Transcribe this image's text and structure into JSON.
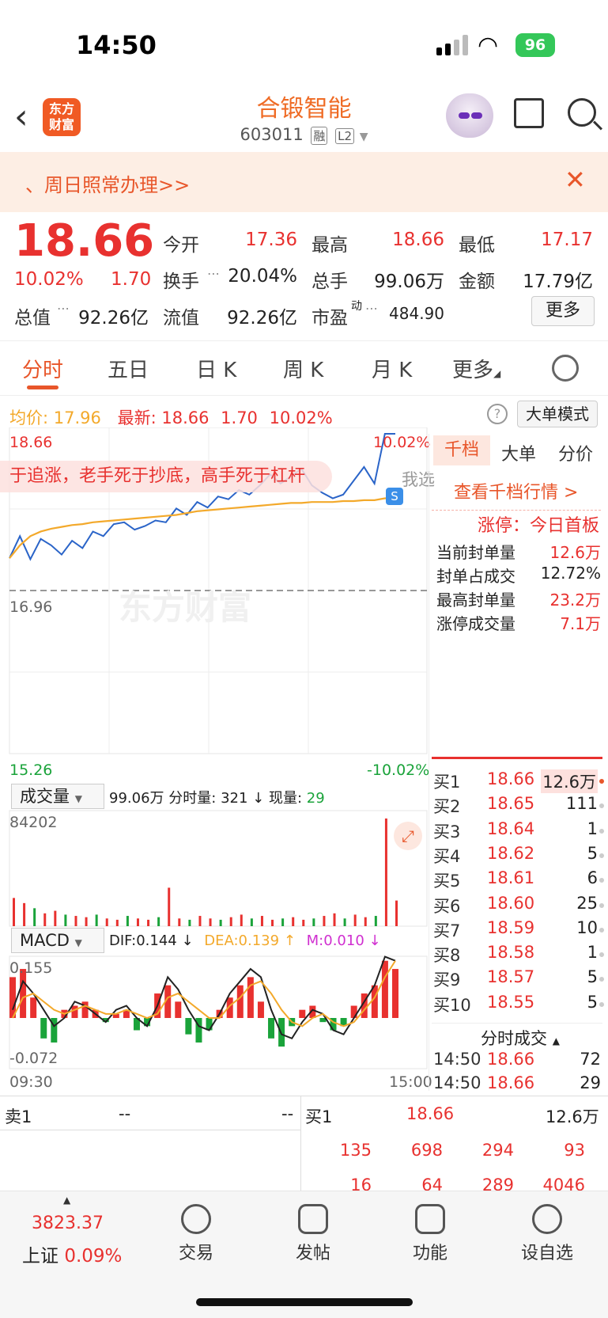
{
  "status": {
    "time": "14:50",
    "battery": "96"
  },
  "header": {
    "title": "合锻智能",
    "code": "603011",
    "tag_margin": "融",
    "tag_level": "L2",
    "logo_line1": "东方",
    "logo_line2": "财富"
  },
  "notice": {
    "text": "、周日照常办理>>",
    "close": "✕"
  },
  "quote": {
    "price": "18.66",
    "change_pct": "10.02%",
    "change": "1.70",
    "open_label": "今开",
    "open": "17.36",
    "high_label": "最高",
    "high": "18.66",
    "low_label": "最低",
    "low": "17.17",
    "turnover_label": "换手",
    "turnover": "20.04%",
    "volume_label": "总手",
    "volume": "99.06万",
    "amount_label": "金额",
    "amount": "17.79亿",
    "mktcap_label": "总值",
    "mktcap": "92.26亿",
    "float_label": "流值",
    "float": "92.26亿",
    "pe_label": "市盈",
    "pe_sup": "动",
    "pe": "484.90",
    "more": "更多"
  },
  "tabs": [
    "分时",
    "五日",
    "日 K",
    "周 K",
    "月 K",
    "更多"
  ],
  "chart_info": {
    "avg_label": "均价:",
    "avg": "17.96",
    "latest_label": "最新:",
    "latest": "18.66",
    "chg": "1.70",
    "pct": "10.02%",
    "big_mode": "大单模式",
    "help": "?"
  },
  "chart_data": {
    "type": "line",
    "y_top": "18.66",
    "y_mid": "16.96",
    "y_bottom": "15.26",
    "pct_top": "10.02%",
    "pct_bottom": "-10.02%",
    "x_start": "09:30",
    "x_end": "15:00",
    "ylim": [
      15.26,
      18.66
    ],
    "watermark": "东方财富",
    "ticker_text": "于追涨，老手死于抄底，高手死于杠杆",
    "ticker_side": "我选",
    "series": [
      {
        "name": "最新",
        "color": "#2a64c8",
        "values": [
          17.31,
          17.55,
          17.3,
          17.52,
          17.45,
          17.35,
          17.5,
          17.42,
          17.6,
          17.55,
          17.68,
          17.7,
          17.62,
          17.66,
          17.72,
          17.7,
          17.85,
          17.78,
          17.92,
          17.86,
          17.98,
          17.95,
          18.05,
          18.0,
          18.1,
          18.22,
          18.12,
          18.2,
          18.28,
          18.1,
          18.02,
          17.96,
          18.0,
          18.15,
          18.3,
          18.12,
          18.66,
          18.66
        ]
      },
      {
        "name": "均价",
        "color": "#f3a92b",
        "values": [
          17.31,
          17.45,
          17.55,
          17.6,
          17.63,
          17.65,
          17.67,
          17.68,
          17.7,
          17.71,
          17.72,
          17.73,
          17.74,
          17.75,
          17.76,
          17.77,
          17.78,
          17.8,
          17.82,
          17.83,
          17.84,
          17.85,
          17.86,
          17.87,
          17.88,
          17.89,
          17.9,
          17.91,
          17.91,
          17.92,
          17.92,
          17.92,
          17.93,
          17.93,
          17.94,
          17.94,
          17.96,
          17.96
        ]
      }
    ],
    "volume_label": "成交量",
    "volume_total": "99.06万",
    "tick_label": "分时量:",
    "tick_vol": "321",
    "now_label": "现量:",
    "now_vol": "29",
    "volume_max": "84202",
    "volume_values": [
      22,
      18,
      14,
      10,
      12,
      9,
      8,
      7,
      9,
      6,
      5,
      8,
      6,
      5,
      7,
      30,
      6,
      5,
      8,
      6,
      5,
      7,
      9,
      6,
      8,
      5,
      6,
      7,
      5,
      6,
      8,
      10,
      6,
      9,
      7,
      8,
      84,
      20
    ],
    "macd_label": "MACD",
    "dif_label": "DIF:0.144 ↓",
    "dea_label": "DEA:0.139 ↑",
    "m_label": "M:0.010 ↓",
    "macd_top": "0.155",
    "macd_bottom": "-0.072",
    "macd_hist": [
      0.1,
      0.12,
      0.05,
      -0.05,
      -0.06,
      0.02,
      0.03,
      0.04,
      0.02,
      -0.01,
      0.01,
      0.02,
      -0.03,
      -0.02,
      0.06,
      0.08,
      0.04,
      -0.04,
      -0.06,
      -0.03,
      0.02,
      0.05,
      0.08,
      0.1,
      0.04,
      -0.05,
      -0.07,
      -0.02,
      0.02,
      0.03,
      -0.01,
      -0.03,
      -0.02,
      0.03,
      0.06,
      0.08,
      0.14,
      0.12
    ],
    "macd_dif": [
      0.02,
      0.09,
      0.06,
      0.02,
      -0.02,
      0.0,
      0.04,
      0.03,
      0.01,
      -0.01,
      0.02,
      0.03,
      0.0,
      -0.02,
      0.03,
      0.1,
      0.07,
      0.02,
      -0.02,
      -0.03,
      0.01,
      0.06,
      0.09,
      0.12,
      0.1,
      0.02,
      -0.04,
      -0.05,
      -0.01,
      0.02,
      0.01,
      -0.03,
      -0.04,
      0.0,
      0.04,
      0.08,
      0.15,
      0.14
    ],
    "macd_dea": [
      0.0,
      0.05,
      0.06,
      0.04,
      0.02,
      0.01,
      0.02,
      0.03,
      0.02,
      0.01,
      0.01,
      0.02,
      0.01,
      0.0,
      0.01,
      0.05,
      0.06,
      0.04,
      0.02,
      0.0,
      0.0,
      0.03,
      0.05,
      0.08,
      0.09,
      0.06,
      0.02,
      -0.01,
      -0.02,
      0.0,
      0.01,
      -0.01,
      -0.02,
      -0.01,
      0.02,
      0.05,
      0.1,
      0.14
    ]
  },
  "right_panel": {
    "tabs": [
      "千档",
      "大单",
      "分价"
    ],
    "link": "查看千档行情 >",
    "limit_label": "涨停：今日首板",
    "stats": [
      {
        "label": "当前封单量",
        "value": "12.6万"
      },
      {
        "label": "封单占成交",
        "value": "12.72%"
      },
      {
        "label": "最高封单量",
        "value": "23.2万"
      },
      {
        "label": "涨停成交量",
        "value": "7.1万"
      }
    ],
    "bids": [
      {
        "label": "买1",
        "price": "18.66",
        "vol": "12.6万"
      },
      {
        "label": "买2",
        "price": "18.65",
        "vol": "111"
      },
      {
        "label": "买3",
        "price": "18.64",
        "vol": "1"
      },
      {
        "label": "买4",
        "price": "18.62",
        "vol": "5"
      },
      {
        "label": "买5",
        "price": "18.61",
        "vol": "6"
      },
      {
        "label": "买6",
        "price": "18.60",
        "vol": "25"
      },
      {
        "label": "买7",
        "price": "18.59",
        "vol": "10"
      },
      {
        "label": "买8",
        "price": "18.58",
        "vol": "1"
      },
      {
        "label": "买9",
        "price": "18.57",
        "vol": "5"
      },
      {
        "label": "买10",
        "price": "18.55",
        "vol": "5"
      }
    ],
    "trades_label": "分时成交",
    "trades": [
      {
        "time": "14:50",
        "price": "18.66",
        "vol": "72"
      },
      {
        "time": "14:50",
        "price": "18.66",
        "vol": "29"
      }
    ]
  },
  "bottom": {
    "sell_label": "卖1",
    "sell_price": "--",
    "sell_vol": "--",
    "buy_label": "买1",
    "buy_price": "18.66",
    "buy_vol": "12.6万",
    "queue_row1": [
      "135",
      "698",
      "294",
      "93"
    ],
    "queue_row2": [
      "16",
      "64",
      "289",
      "4046"
    ]
  },
  "tabbar": {
    "index_value": "3823.37",
    "index_name": "上证",
    "index_pct": "0.09%",
    "items": [
      "交易",
      "发帖",
      "功能",
      "设自选"
    ]
  }
}
